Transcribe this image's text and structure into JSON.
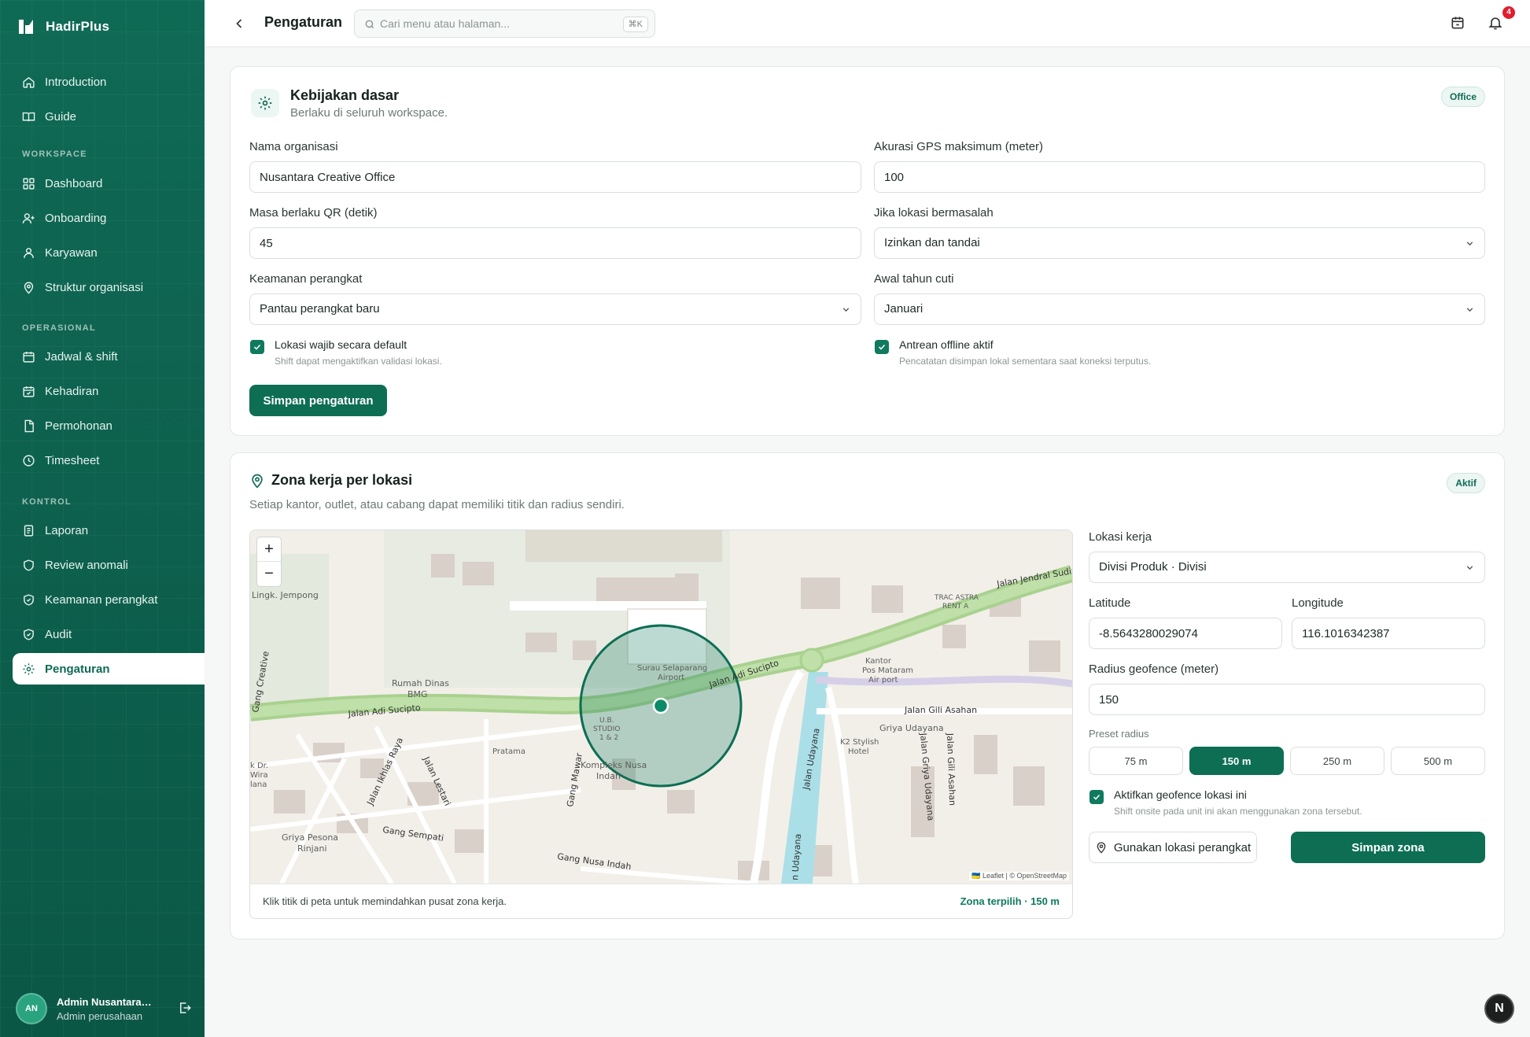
{
  "app": {
    "name": "HadirPlus"
  },
  "sidebar": {
    "top_items": [
      {
        "label": "Introduction",
        "icon": "home-icon"
      },
      {
        "label": "Guide",
        "icon": "book-icon"
      }
    ],
    "sections": [
      {
        "title": "WORKSPACE",
        "items": [
          {
            "label": "Dashboard",
            "icon": "grid-icon"
          },
          {
            "label": "Onboarding",
            "icon": "user-plus-icon"
          },
          {
            "label": "Karyawan",
            "icon": "user-icon"
          },
          {
            "label": "Struktur organisasi",
            "icon": "pin-icon"
          }
        ]
      },
      {
        "title": "OPERASIONAL",
        "items": [
          {
            "label": "Jadwal & shift",
            "icon": "calendar-icon"
          },
          {
            "label": "Kehadiran",
            "icon": "calendar-check-icon"
          },
          {
            "label": "Permohonan",
            "icon": "document-icon"
          },
          {
            "label": "Timesheet",
            "icon": "clock-icon"
          }
        ]
      },
      {
        "title": "KONTROL",
        "items": [
          {
            "label": "Laporan",
            "icon": "report-icon"
          },
          {
            "label": "Review anomali",
            "icon": "shield-icon"
          },
          {
            "label": "Keamanan perangkat",
            "icon": "shield-check-icon"
          },
          {
            "label": "Audit",
            "icon": "shield-check-icon"
          },
          {
            "label": "Pengaturan",
            "icon": "gear-icon",
            "active": true
          }
        ]
      }
    ],
    "user": {
      "initials": "AN",
      "name": "Admin Nusantara Creative Office",
      "role": "Admin perusahaan"
    }
  },
  "topbar": {
    "title": "Pengaturan",
    "search_placeholder": "Cari menu atau halaman...",
    "shortcut": "⌘K",
    "notification_count": "4"
  },
  "policy": {
    "title": "Kebijakan dasar",
    "subtitle": "Berlaku di seluruh workspace.",
    "badge": "Office",
    "org_name": {
      "label": "Nama organisasi",
      "value": "Nusantara Creative Office"
    },
    "gps_accuracy": {
      "label": "Akurasi GPS maksimum (meter)",
      "value": "100"
    },
    "qr_validity": {
      "label": "Masa berlaku QR (detik)",
      "value": "45"
    },
    "location_issue": {
      "label": "Jika lokasi bermasalah",
      "value": "Izinkan dan tandai"
    },
    "device_security": {
      "label": "Keamanan perangkat",
      "value": "Pantau perangkat baru"
    },
    "leave_year_start": {
      "label": "Awal tahun cuti",
      "value": "Januari"
    },
    "location_required": {
      "label": "Lokasi wajib secara default",
      "hint": "Shift dapat mengaktifkan validasi lokasi.",
      "checked": true
    },
    "offline_queue": {
      "label": "Antrean offline aktif",
      "hint": "Pencatatan disimpan lokal sementara saat koneksi terputus.",
      "checked": true
    },
    "save_label": "Simpan pengaturan"
  },
  "zone": {
    "title": "Zona kerja per lokasi",
    "subtitle": "Setiap kantor, outlet, atau cabang dapat memiliki titik dan radius sendiri.",
    "badge": "Aktif",
    "map_hint": "Klik titik di peta untuk memindahkan pusat zona kerja.",
    "map_selected": "Zona terpilih · 150 m",
    "attribution": "🇺🇦 Leaflet | © OpenStreetMap",
    "zoom_in": "+",
    "zoom_out": "−",
    "map_labels": {
      "jempong": "Lingk. Jempong",
      "rumah_dinas": "Rumah Dinas",
      "bmg": "BMG",
      "surau": "Surau Selaparang",
      "airport": "Airport",
      "adi_sucipto_left": "Jalan Adi Sucipto",
      "adi_sucipto_right": "Jalan Adi Sucipto",
      "jendral_sudirman": "Jalan Jendral Sudirn",
      "kantor_pos_1": "Kantor",
      "kantor_pos_2": "Pos Mataram",
      "kantor_pos_3": "Air port",
      "gili_asahan": "Jalan Gili Asahan",
      "griya_udayana": "Griya Udayana",
      "k2_stylish": "K2 Stylish",
      "hotel": "Hotel",
      "kompleks_1": "Kompleks Nusa",
      "kompleks_2": "Indah",
      "gang_sempati": "Gang Sempati",
      "gang_nusa_indah": "Gang Nusa Indah",
      "griya_pesona_1": "Griya Pesona",
      "griya_pesona_2": "Rinjani",
      "pratama": "Pratama",
      "jalan_udayana": "Jalan Udayana",
      "jalan_udayana_2": "n Udayana",
      "jalan_ikhlas": "Jalan Ikhlas Raya",
      "jalan_lestari": "Jalan Lestari",
      "gang_mawar": "Gang Mawar",
      "jalan_griya_udayana": "Jalan Griya Udayana",
      "jalan_gili_asahan_v": "Jalan Gili Asahan",
      "gang_creative": "Gang Creative",
      "trac_astra": "TRAC ASTRA",
      "rent_a": "RENT A",
      "studio_1": "U.B.",
      "studio_2": "STUDIO",
      "studio_3": "1 & 2",
      "wira_1": "k Dr.",
      "wira_2": "Wira",
      "wira_3": "lana"
    },
    "location": {
      "label": "Lokasi kerja",
      "value": "Divisi Produk · Divisi"
    },
    "latitude": {
      "label": "Latitude",
      "value": "-8.5643280029074"
    },
    "longitude": {
      "label": "Longitude",
      "value": "116.1016342387"
    },
    "radius": {
      "label": "Radius geofence (meter)",
      "value": "150"
    },
    "preset_label": "Preset radius",
    "presets": [
      "75 m",
      "150 m",
      "250 m",
      "500 m"
    ],
    "preset_active": "150 m",
    "geofence_toggle": {
      "label": "Aktifkan geofence lokasi ini",
      "hint": "Shift onsite pada unit ini akan menggunakan zona tersebut.",
      "checked": true
    },
    "use_device_label": "Gunakan lokasi perangkat",
    "save_label": "Simpan zona"
  },
  "fab_label": "N",
  "colors": {
    "brand": "#0f6a55",
    "accent": "#0d6e54",
    "badge_red": "#e11d2e"
  }
}
